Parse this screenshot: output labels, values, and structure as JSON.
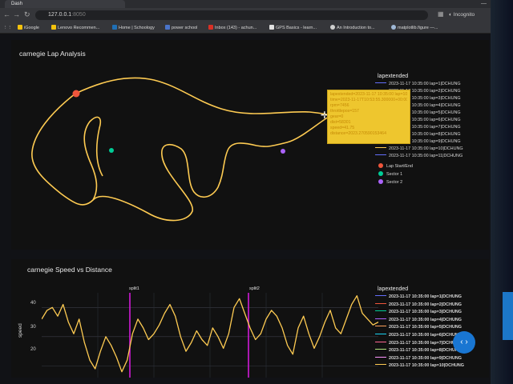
{
  "browser": {
    "tab_title": "Dash",
    "url": "127.0.0.1",
    "port": ":8050",
    "profile": "Incognito",
    "bookmarks": [
      "iGoogle",
      "Lenovo Recommen...",
      "Home | Schoology",
      "power school",
      "Inbox (143) - achun...",
      "GPS Basics - learn...",
      "An Introduction to...",
      "matplotlib.figure —..."
    ]
  },
  "lap_chart": {
    "title": "carnegie Lap Analysis",
    "legend_title": "lapextended",
    "legend_items": [
      {
        "label": "2023-11-17 10:35:00 lap=1|DCHUNG",
        "color": "#636efa"
      },
      {
        "label": "2023-11-17 10:35:00 lap=2|DCHUNG",
        "color": "#ef553b"
      },
      {
        "label": "2023-11-17 10:35:00 lap=3|DCHUNG",
        "color": "#00cc96"
      },
      {
        "label": "2023-11-17 10:35:00 lap=4|DCHUNG",
        "color": "#ab63fa"
      },
      {
        "label": "2023-11-17 10:35:00 lap=5|DCHUNG",
        "color": "#ffa15a"
      },
      {
        "label": "2023-11-17 10:35:00 lap=6|DCHUNG",
        "color": "#19d3f3"
      },
      {
        "label": "2023-11-17 10:35:00 lap=7|DCHUNG",
        "color": "#ff6692"
      },
      {
        "label": "2023-11-17 10:35:00 lap=8|DCHUNG",
        "color": "#b6e880"
      },
      {
        "label": "2023-11-17 10:35:00 lap=9|DCHUNG",
        "color": "#ff97ff"
      },
      {
        "label": "2023-11-17 10:35:00 lap=10|DCHUNG",
        "color": "#fecb52"
      },
      {
        "label": "2023-11-17 10:35:00 lap=11|DCHUNG",
        "color": "#636efa"
      }
    ],
    "marker_items": [
      {
        "label": "Lap Start/End",
        "color": "#ef553b"
      },
      {
        "label": "Sector 1",
        "color": "#00cc96"
      },
      {
        "label": "Sector 2",
        "color": "#ab63fa"
      }
    ],
    "hover_lines": [
      "lapextended=2023-11-17 10:35:00 lap=10|DCHUNG",
      "time=2023-11-17T10:53:55.300000+00:00",
      "rpm=7456",
      "throttlepos=157",
      "gear=0",
      "dist=58301",
      "speed=41.75",
      "distance=2023.270590153464"
    ],
    "track_color": "#fecb52"
  },
  "speed_chart": {
    "title": "carnegie Speed vs Distance",
    "ylabel": "speed",
    "y_ticks": [
      "40",
      "30",
      "20"
    ],
    "split_labels": [
      "split1",
      "split2"
    ],
    "split_color": "#d21bd8",
    "line_color": "#fecb52",
    "legend_title": "lapextended"
  },
  "chart_data": {
    "type": "line",
    "title": "carnegie Speed vs Distance",
    "ylabel": "speed",
    "ylim": [
      16,
      45
    ],
    "series": [
      {
        "name": "2023-11-17 10:35:00 lap=10|DCHUNG",
        "values": [
          36,
          39,
          40,
          37,
          41,
          35,
          31,
          36,
          28,
          22,
          19,
          25,
          30,
          27,
          23,
          18,
          22,
          31,
          36,
          33,
          29,
          31,
          34,
          38,
          41,
          37,
          30,
          25,
          28,
          32,
          29,
          27,
          33,
          30,
          26,
          31,
          40,
          43,
          38,
          33,
          29,
          31,
          36,
          39,
          37,
          33,
          27,
          24,
          33,
          37,
          31,
          26,
          30,
          35,
          39,
          33,
          31,
          36,
          41,
          44,
          38,
          36,
          34,
          35
        ]
      }
    ]
  }
}
